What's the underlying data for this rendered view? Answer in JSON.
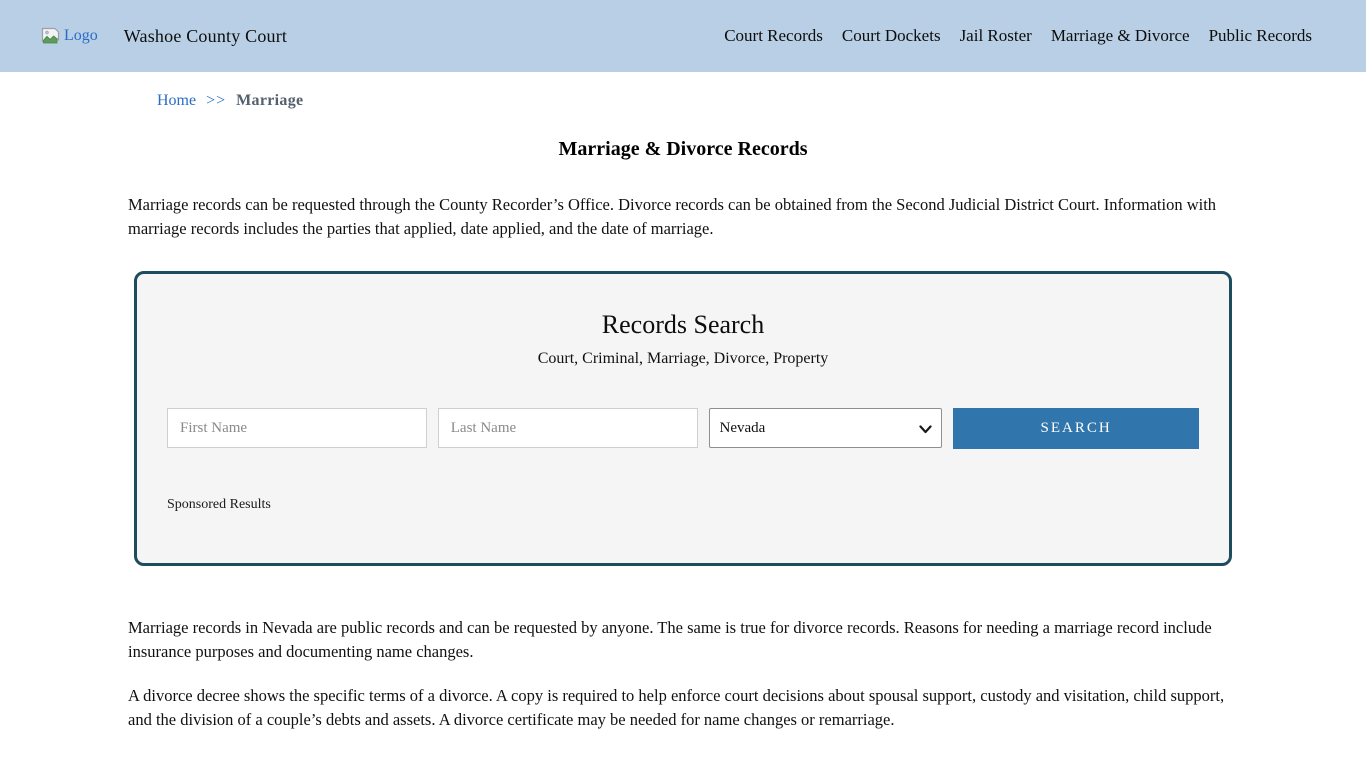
{
  "header": {
    "logo_alt": "Logo",
    "brand": "Washoe County Court",
    "nav": [
      {
        "label": "Court Records"
      },
      {
        "label": "Court Dockets"
      },
      {
        "label": "Jail Roster"
      },
      {
        "label": "Marriage & Divorce"
      },
      {
        "label": "Public Records"
      }
    ]
  },
  "breadcrumb": {
    "home": "Home",
    "separator": ">>",
    "current": "Marriage"
  },
  "page": {
    "title": "Marriage & Divorce Records",
    "intro": "Marriage records can be requested through the County Recorder’s Office. Divorce records can be obtained from the Second Judicial District Court. Information with marriage records includes the parties that applied, date applied, and the date of marriage.",
    "paragraph2": "Marriage records in Nevada are public records and can be requested by anyone. The same is true for divorce records. Reasons for needing a marriage record include insurance purposes and documenting name changes.",
    "paragraph3": "A divorce decree shows the specific terms of a divorce. A copy is required to help enforce court decisions about spousal support, custody and visitation, child support, and the division of a couple’s debts and assets. A divorce certificate may be needed for name changes or remarriage."
  },
  "search_panel": {
    "title": "Records Search",
    "subtitle": "Court, Criminal, Marriage, Divorce, Property",
    "first_name_placeholder": "First Name",
    "last_name_placeholder": "Last Name",
    "state_selected": "Nevada",
    "search_label": "SEARCH",
    "sponsored": "Sponsored Results"
  },
  "colors": {
    "header_bg": "#b8cfe5",
    "panel_border": "#1e4c5f",
    "panel_bg": "#f5f5f6",
    "button_bg": "#3076ad",
    "link_blue": "#2b6cc4",
    "breadcrumb_current": "#55606e"
  }
}
